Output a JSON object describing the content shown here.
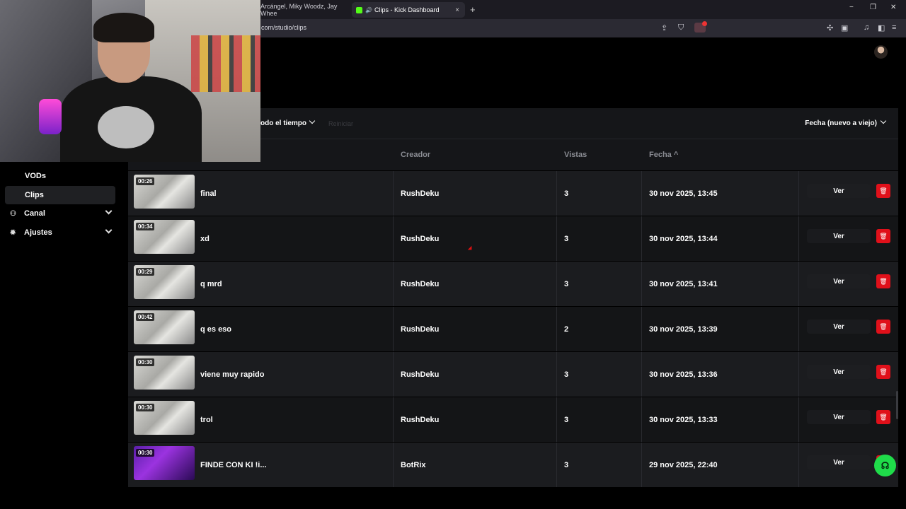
{
  "browser": {
    "tabs": [
      {
        "title": "Arcángel, Miky Woodz, Jay Whee",
        "active": false
      },
      {
        "title": "Clips - Kick Dashboard",
        "active": true
      }
    ],
    "url": "com/studio/clips",
    "new_tab": "+",
    "window_controls": [
      "−",
      "❐",
      "✕"
    ],
    "close_tab": "×"
  },
  "sidebar": {
    "items": [
      {
        "label": "VODs",
        "active": false,
        "icon": ""
      },
      {
        "label": "Clips",
        "active": true,
        "icon": ""
      },
      {
        "label": "Canal",
        "active": false,
        "icon": "people-icon"
      },
      {
        "label": "Ajustes",
        "active": false,
        "icon": "gear-icon"
      }
    ]
  },
  "filters": {
    "time_label": "odo el tiempo",
    "reset_label": "Reiniciar",
    "sort_label": "Fecha (nuevo a viejo)"
  },
  "table": {
    "headers": {
      "creator": "Creador",
      "views": "Vistas",
      "date": "Fecha ^"
    },
    "view_label": "Ver",
    "delete_icon": "trash-icon",
    "rows": [
      {
        "duration": "00:26",
        "title": "final",
        "creator": "RushDeku",
        "views": "3",
        "date": "30 nov 2025, 13:45",
        "thumb": "gray"
      },
      {
        "duration": "00:34",
        "title": "xd",
        "creator": "RushDeku",
        "views": "3",
        "date": "30 nov 2025, 13:44",
        "thumb": "gray"
      },
      {
        "duration": "00:29",
        "title": "q mrd",
        "creator": "RushDeku",
        "views": "3",
        "date": "30 nov 2025, 13:41",
        "thumb": "gray"
      },
      {
        "duration": "00:42",
        "title": "q es eso",
        "creator": "RushDeku",
        "views": "2",
        "date": "30 nov 2025, 13:39",
        "thumb": "gray"
      },
      {
        "duration": "00:30",
        "title": "viene muy rapido",
        "creator": "RushDeku",
        "views": "3",
        "date": "30 nov 2025, 13:36",
        "thumb": "gray"
      },
      {
        "duration": "00:30",
        "title": "trol",
        "creator": "RushDeku",
        "views": "3",
        "date": "30 nov 2025, 13:33",
        "thumb": "gray"
      },
      {
        "duration": "00:30",
        "title": "FINDE CON KI !i...",
        "creator": "BotRix",
        "views": "3",
        "date": "29 nov 2025, 22:40",
        "thumb": "purple"
      }
    ]
  },
  "colors": {
    "accent": "#53fc18",
    "delete": "#e0101a",
    "help": "#1fdc4a"
  }
}
